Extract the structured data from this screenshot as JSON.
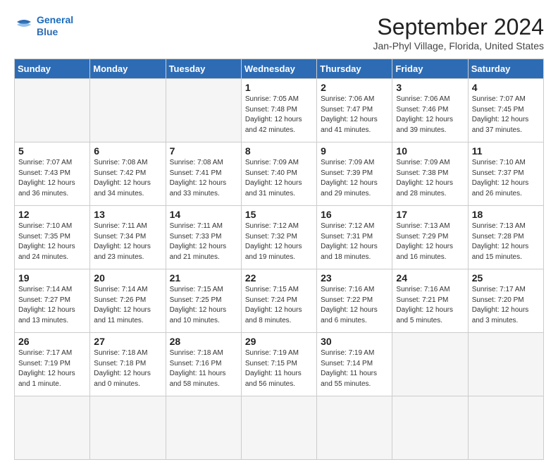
{
  "header": {
    "logo_line1": "General",
    "logo_line2": "Blue",
    "month": "September 2024",
    "location": "Jan-Phyl Village, Florida, United States"
  },
  "weekdays": [
    "Sunday",
    "Monday",
    "Tuesday",
    "Wednesday",
    "Thursday",
    "Friday",
    "Saturday"
  ],
  "days": [
    {
      "num": "",
      "info": ""
    },
    {
      "num": "",
      "info": ""
    },
    {
      "num": "",
      "info": ""
    },
    {
      "num": "1",
      "info": "Sunrise: 7:05 AM\nSunset: 7:48 PM\nDaylight: 12 hours\nand 42 minutes."
    },
    {
      "num": "2",
      "info": "Sunrise: 7:06 AM\nSunset: 7:47 PM\nDaylight: 12 hours\nand 41 minutes."
    },
    {
      "num": "3",
      "info": "Sunrise: 7:06 AM\nSunset: 7:46 PM\nDaylight: 12 hours\nand 39 minutes."
    },
    {
      "num": "4",
      "info": "Sunrise: 7:07 AM\nSunset: 7:45 PM\nDaylight: 12 hours\nand 37 minutes."
    },
    {
      "num": "5",
      "info": "Sunrise: 7:07 AM\nSunset: 7:43 PM\nDaylight: 12 hours\nand 36 minutes."
    },
    {
      "num": "6",
      "info": "Sunrise: 7:08 AM\nSunset: 7:42 PM\nDaylight: 12 hours\nand 34 minutes."
    },
    {
      "num": "7",
      "info": "Sunrise: 7:08 AM\nSunset: 7:41 PM\nDaylight: 12 hours\nand 33 minutes."
    },
    {
      "num": "8",
      "info": "Sunrise: 7:09 AM\nSunset: 7:40 PM\nDaylight: 12 hours\nand 31 minutes."
    },
    {
      "num": "9",
      "info": "Sunrise: 7:09 AM\nSunset: 7:39 PM\nDaylight: 12 hours\nand 29 minutes."
    },
    {
      "num": "10",
      "info": "Sunrise: 7:09 AM\nSunset: 7:38 PM\nDaylight: 12 hours\nand 28 minutes."
    },
    {
      "num": "11",
      "info": "Sunrise: 7:10 AM\nSunset: 7:37 PM\nDaylight: 12 hours\nand 26 minutes."
    },
    {
      "num": "12",
      "info": "Sunrise: 7:10 AM\nSunset: 7:35 PM\nDaylight: 12 hours\nand 24 minutes."
    },
    {
      "num": "13",
      "info": "Sunrise: 7:11 AM\nSunset: 7:34 PM\nDaylight: 12 hours\nand 23 minutes."
    },
    {
      "num": "14",
      "info": "Sunrise: 7:11 AM\nSunset: 7:33 PM\nDaylight: 12 hours\nand 21 minutes."
    },
    {
      "num": "15",
      "info": "Sunrise: 7:12 AM\nSunset: 7:32 PM\nDaylight: 12 hours\nand 19 minutes."
    },
    {
      "num": "16",
      "info": "Sunrise: 7:12 AM\nSunset: 7:31 PM\nDaylight: 12 hours\nand 18 minutes."
    },
    {
      "num": "17",
      "info": "Sunrise: 7:13 AM\nSunset: 7:29 PM\nDaylight: 12 hours\nand 16 minutes."
    },
    {
      "num": "18",
      "info": "Sunrise: 7:13 AM\nSunset: 7:28 PM\nDaylight: 12 hours\nand 15 minutes."
    },
    {
      "num": "19",
      "info": "Sunrise: 7:14 AM\nSunset: 7:27 PM\nDaylight: 12 hours\nand 13 minutes."
    },
    {
      "num": "20",
      "info": "Sunrise: 7:14 AM\nSunset: 7:26 PM\nDaylight: 12 hours\nand 11 minutes."
    },
    {
      "num": "21",
      "info": "Sunrise: 7:15 AM\nSunset: 7:25 PM\nDaylight: 12 hours\nand 10 minutes."
    },
    {
      "num": "22",
      "info": "Sunrise: 7:15 AM\nSunset: 7:24 PM\nDaylight: 12 hours\nand 8 minutes."
    },
    {
      "num": "23",
      "info": "Sunrise: 7:16 AM\nSunset: 7:22 PM\nDaylight: 12 hours\nand 6 minutes."
    },
    {
      "num": "24",
      "info": "Sunrise: 7:16 AM\nSunset: 7:21 PM\nDaylight: 12 hours\nand 5 minutes."
    },
    {
      "num": "25",
      "info": "Sunrise: 7:17 AM\nSunset: 7:20 PM\nDaylight: 12 hours\nand 3 minutes."
    },
    {
      "num": "26",
      "info": "Sunrise: 7:17 AM\nSunset: 7:19 PM\nDaylight: 12 hours\nand 1 minute."
    },
    {
      "num": "27",
      "info": "Sunrise: 7:18 AM\nSunset: 7:18 PM\nDaylight: 12 hours\nand 0 minutes."
    },
    {
      "num": "28",
      "info": "Sunrise: 7:18 AM\nSunset: 7:16 PM\nDaylight: 11 hours\nand 58 minutes."
    },
    {
      "num": "29",
      "info": "Sunrise: 7:19 AM\nSunset: 7:15 PM\nDaylight: 11 hours\nand 56 minutes."
    },
    {
      "num": "30",
      "info": "Sunrise: 7:19 AM\nSunset: 7:14 PM\nDaylight: 11 hours\nand 55 minutes."
    },
    {
      "num": "",
      "info": ""
    },
    {
      "num": "",
      "info": ""
    },
    {
      "num": "",
      "info": ""
    },
    {
      "num": "",
      "info": ""
    },
    {
      "num": "",
      "info": ""
    }
  ]
}
